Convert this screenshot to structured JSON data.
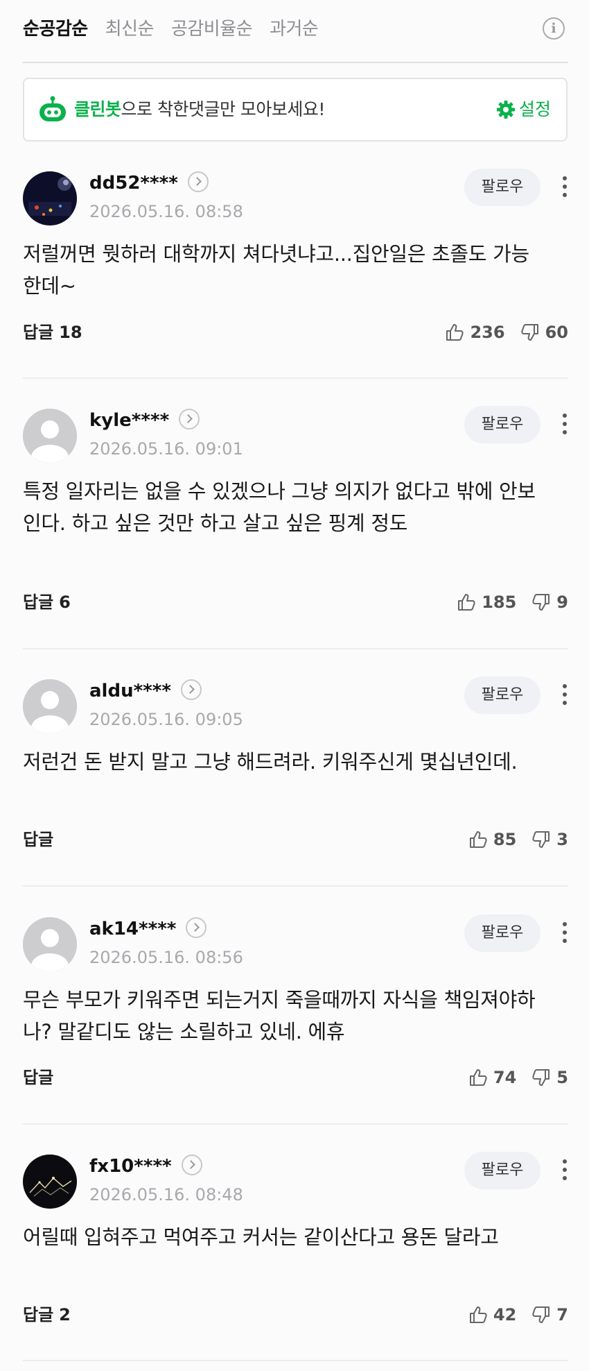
{
  "sort_tabs": [
    {
      "label": "순공감순",
      "active": true
    },
    {
      "label": "최신순",
      "active": false
    },
    {
      "label": "공감비율순",
      "active": false
    },
    {
      "label": "과거순",
      "active": false
    }
  ],
  "info_icon_glyph": "i",
  "cleanbot": {
    "brand": "클린봇",
    "message": "으로 착한댓글만 모아보세요!",
    "settings_label": "설정",
    "accent_color": "#0bb14c"
  },
  "comments": [
    {
      "username": "dd52****",
      "timestamp": "2026.05.16. 08:58",
      "follow_label": "팔로우",
      "text": "저럴꺼면 뭣하러 대학까지 쳐다녓냐고...집안일은 초졸도 가능한데~",
      "reply_label": "답글",
      "reply_count": "18",
      "likes": "236",
      "dislikes": "60",
      "avatar": "dark-photo"
    },
    {
      "username": "kyle****",
      "timestamp": "2026.05.16. 09:01",
      "follow_label": "팔로우",
      "text": "특정 일자리는 없을 수 있겠으나 그냥 의지가 없다고 밖에 안보인다. 하고 싶은 것만 하고 살고 싶은 핑계 정도",
      "reply_label": "답글",
      "reply_count": "6",
      "likes": "185",
      "dislikes": "9",
      "avatar": "default"
    },
    {
      "username": "aldu****",
      "timestamp": "2026.05.16. 09:05",
      "follow_label": "팔로우",
      "text": "저런건 돈 받지 말고 그냥 해드려라. 키워주신게 몇십년인데.",
      "reply_label": "답글",
      "reply_count": "",
      "likes": "85",
      "dislikes": "3",
      "avatar": "default"
    },
    {
      "username": "ak14****",
      "timestamp": "2026.05.16. 08:56",
      "follow_label": "팔로우",
      "text": "무슨 부모가 키워주면 되는거지 죽을때까지 자식을 책임져야하나? 말같디도 않는 소릴하고 있네. 에휴",
      "reply_label": "답글",
      "reply_count": "",
      "likes": "74",
      "dislikes": "5",
      "avatar": "default"
    },
    {
      "username": "fx10****",
      "timestamp": "2026.05.16. 08:48",
      "follow_label": "팔로우",
      "text": "어릴때 입혀주고 먹여주고 커서는 같이산다고 용돈 달라고",
      "reply_label": "답글",
      "reply_count": "2",
      "likes": "42",
      "dislikes": "7",
      "avatar": "dark-photo-2"
    }
  ]
}
